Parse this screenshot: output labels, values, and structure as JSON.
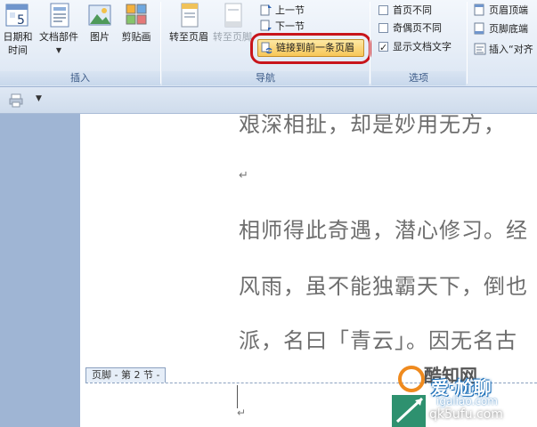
{
  "ribbon": {
    "insert_group": {
      "label": "插入",
      "date_time_label": "日期和\n时间",
      "date_time_line1": "日期和",
      "date_time_line2": "时间",
      "doc_parts_label": "文档部件",
      "picture_label": "图片",
      "clipart_label": "剪贴画"
    },
    "nav_group": {
      "label": "导航",
      "goto_header_label": "转至页眉",
      "goto_footer_label": "转至页脚",
      "prev_section_label": "上一节",
      "next_section_label": "下一节",
      "link_prev_label": "链接到前一条页眉"
    },
    "options_group": {
      "label": "选项",
      "first_page_diff_label": "首页不同",
      "odd_even_diff_label": "奇偶页不同",
      "show_doc_text_label": "显示文档文字",
      "first_page_diff_checked": false,
      "odd_even_diff_checked": false,
      "show_doc_text_checked": true
    },
    "position_group": {
      "header_top_label": "页眉顶端",
      "footer_bottom_label": "页脚底端",
      "insert_align_label": "插入“对齐"
    },
    "calendar_icon_text": "5"
  },
  "document": {
    "lines": [
      "艰深相扯，却是妙用无方，",
      "相师得此奇遇，潜心修习。经",
      "风雨，虽不能独霸天下，倒也",
      "派，名曰「青云」。因无名古"
    ],
    "footer_tag": "页脚 - 第 2 节 -"
  },
  "watermark": {
    "line1": "爱·尬聊",
    "line2": "igaliao.com",
    "line3": "qk5ufu.com",
    "brand_partial": "酷知网"
  },
  "colors": {
    "highlight_ring": "#c8151b",
    "button_highlight": "#f7c658",
    "ribbon_label": "#3b5a87"
  }
}
